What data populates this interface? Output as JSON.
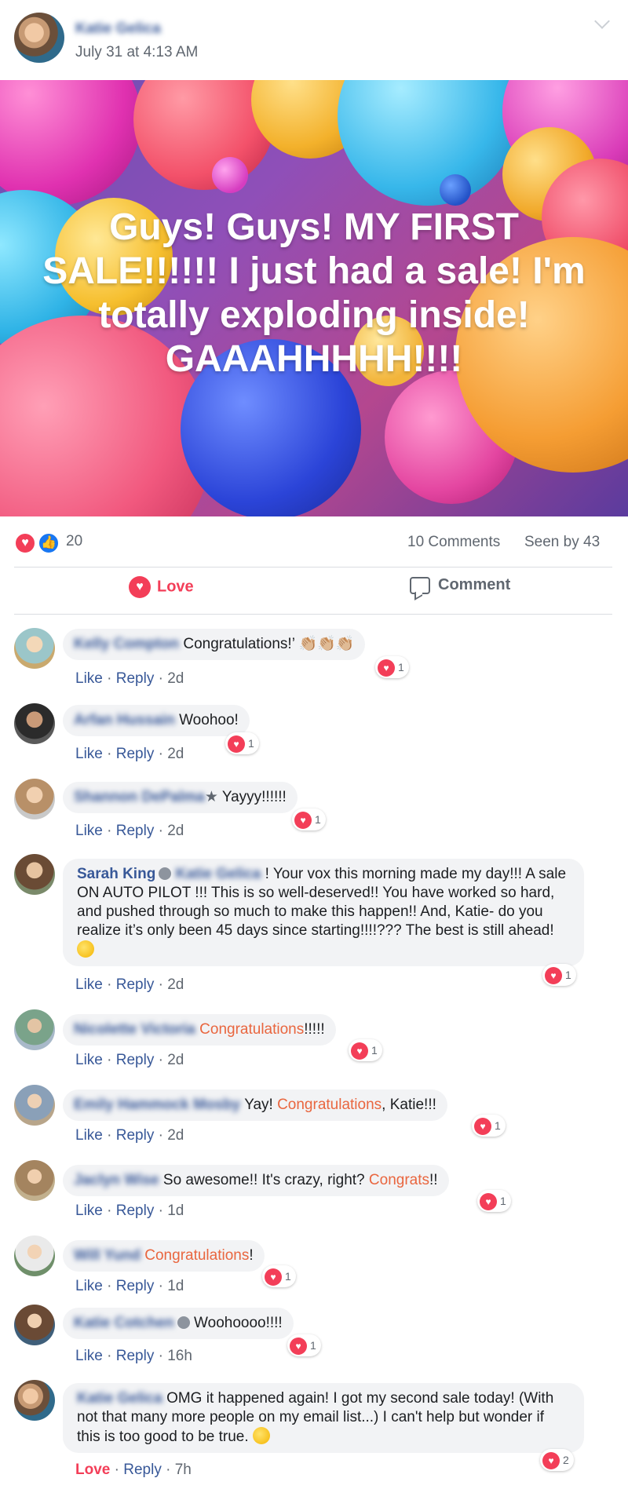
{
  "post": {
    "author": "Katie Gelica",
    "time": "July 31 at 4:13 AM",
    "banner_text": "Guys! Guys! MY FIRST SALE!!!!!! I just had a sale! I'm totally exploding inside! GAAAHHHHH!!!!"
  },
  "stats": {
    "reactions": "20",
    "comments": "10 Comments",
    "seen": "Seen by 43"
  },
  "actions": {
    "love": "Love",
    "comment": "Comment"
  },
  "colors": {
    "love": "#f33e58",
    "link": "#385898",
    "highlight": "#e9663f",
    "bubble": "#f2f3f5"
  },
  "comments": [
    {
      "name": "Kelly Compton",
      "text": "Congratulations!’ 👏🏼👏🏼👏🏼",
      "hearts": "1",
      "like": "Like",
      "reply": "Reply",
      "age": "2d"
    },
    {
      "name": "Arfan Hussain",
      "text": "Woohoo!",
      "hearts": "1",
      "like": "Like",
      "reply": "Reply",
      "age": "2d"
    },
    {
      "name": "Shannon DePalma",
      "text": "Yayyy!!!!!!",
      "hearts": "1",
      "like": "Like",
      "reply": "Reply",
      "age": "2d"
    },
    {
      "name": "Sarah King",
      "mention": "Katie Gelica",
      "text": "! Your vox this morning made my day!!! A sale ON AUTO PILOT !!! This is so well-deserved!! You have worked so hard, and pushed through so much to make this happen!! And, Katie- do you realize it’s only been 45 days since starting!!!!??? The best is still ahead!",
      "hearts": "1",
      "like": "Like",
      "reply": "Reply",
      "age": "2d"
    },
    {
      "name": "Nicolette Victoria",
      "text_highlight": "Congratulations",
      "text_after": "!!!!!",
      "hearts": "1",
      "like": "Like",
      "reply": "Reply",
      "age": "2d"
    },
    {
      "name": "Emily Hammock Mosby",
      "text_before": "Yay!",
      "text_highlight": "Congratulations",
      "text_after": ", Katie!!!",
      "hearts": "1",
      "like": "Like",
      "reply": "Reply",
      "age": "2d"
    },
    {
      "name": "Jaclyn Wise",
      "text_before": "So awesome!! It's crazy, right?",
      "text_highlight": "Congrats",
      "text_after": "!!",
      "hearts": "1",
      "like": "Like",
      "reply": "Reply",
      "age": "1d"
    },
    {
      "name": "Will Yund",
      "text_highlight": "Congratulations",
      "text_after": "!",
      "hearts": "1",
      "like": "Like",
      "reply": "Reply",
      "age": "1d"
    },
    {
      "name": "Katie Cotchen",
      "text": "Woohoooo!!!!",
      "hearts": "1",
      "like": "Like",
      "reply": "Reply",
      "age": "16h"
    },
    {
      "name": "Katie Gelica",
      "text": "OMG it happened again! I got my second sale today! (With not that many more people on my email list...) I can't help but wonder if this is too good to be true.",
      "hearts": "2",
      "like": "Love",
      "reply": "Reply",
      "age": "7h"
    }
  ]
}
